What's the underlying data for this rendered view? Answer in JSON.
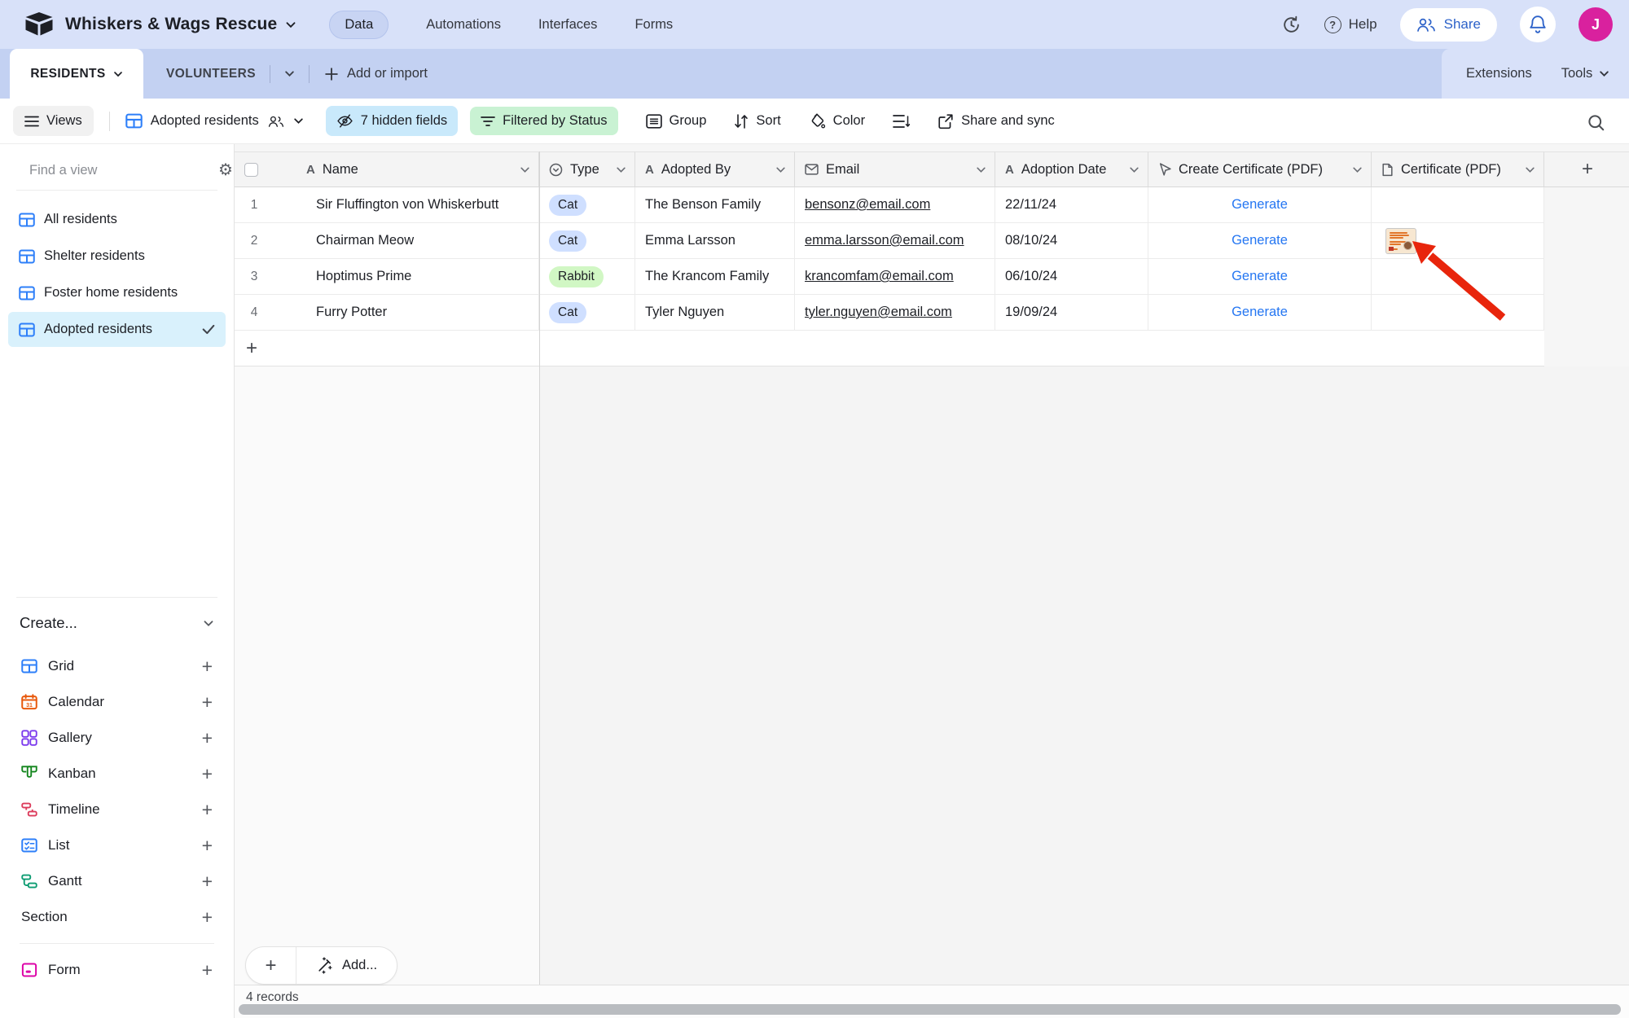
{
  "topbar": {
    "title": "Whiskers & Wags Rescue",
    "tabs": {
      "data": "Data",
      "automations": "Automations",
      "interfaces": "Interfaces",
      "forms": "Forms"
    },
    "help_label": "Help",
    "share_label": "Share",
    "avatar_initial": "J"
  },
  "tabbar": {
    "active_table": "RESIDENTS",
    "second_table": "VOLUNTEERS",
    "add_or_import_label": "Add or import",
    "extensions_label": "Extensions",
    "tools_label": "Tools"
  },
  "toolbar": {
    "views_label": "Views",
    "view_name": "Adopted residents",
    "hidden_fields_label": "7 hidden fields",
    "filter_label": "Filtered by Status",
    "group_label": "Group",
    "sort_label": "Sort",
    "color_label": "Color",
    "share_sync_label": "Share and sync"
  },
  "sidebar": {
    "find_placeholder": "Find a view",
    "views": [
      {
        "label": "All residents",
        "selected": false
      },
      {
        "label": "Shelter residents",
        "selected": false
      },
      {
        "label": "Foster home residents",
        "selected": false
      },
      {
        "label": "Adopted residents",
        "selected": true
      }
    ],
    "create_label": "Create...",
    "create_items": [
      {
        "label": "Grid"
      },
      {
        "label": "Calendar"
      },
      {
        "label": "Gallery"
      },
      {
        "label": "Kanban"
      },
      {
        "label": "Timeline"
      },
      {
        "label": "List"
      },
      {
        "label": "Gantt"
      },
      {
        "label": "Section"
      },
      {
        "label": "Form"
      }
    ]
  },
  "table": {
    "columns": [
      {
        "label": "Name",
        "type": "single-line-text"
      },
      {
        "label": "Type",
        "type": "single-select"
      },
      {
        "label": "Adopted By",
        "type": "single-line-text"
      },
      {
        "label": "Email",
        "type": "email"
      },
      {
        "label": "Adoption Date",
        "type": "single-line-text"
      },
      {
        "label": "Create Certificate (PDF)",
        "type": "button"
      },
      {
        "label": "Certificate (PDF)",
        "type": "attachment"
      }
    ],
    "rows": [
      {
        "num": "1",
        "name": "Sir Fluffington von Whiskerbutt",
        "type": "Cat",
        "chip_style": "background:#cfdfff",
        "adopted_by": "The Benson Family",
        "email": "bensonz@email.com",
        "date": "22/11/24",
        "action": "Generate",
        "attachment": ""
      },
      {
        "num": "2",
        "name": "Chairman Meow",
        "type": "Cat",
        "chip_style": "background:#cfdfff",
        "adopted_by": "Emma Larsson",
        "email": "emma.larsson@email.com",
        "date": "08/10/24",
        "action": "Generate",
        "attachment": "certificate-thumbnail"
      },
      {
        "num": "3",
        "name": "Hoptimus Prime",
        "type": "Rabbit",
        "chip_style": "background:#d1f7c4",
        "adopted_by": "The Krancom Family",
        "email": "krancomfam@email.com",
        "date": "06/10/24",
        "action": "Generate",
        "attachment": ""
      },
      {
        "num": "4",
        "name": "Furry Potter",
        "type": "Cat",
        "chip_style": "background:#cfdfff",
        "adopted_by": "Tyler Nguyen",
        "email": "tyler.nguyen@email.com",
        "date": "19/09/24",
        "action": "Generate",
        "attachment": ""
      }
    ],
    "add_button_label": "Add...",
    "records_label": "4 records"
  },
  "colors": {
    "topbar_bg": "#d8e1f9",
    "tabbar_bg": "#c3d1f2",
    "accent_blue": "#2d7ff9",
    "hidden_fields_pill": "#c9e9fb",
    "filter_pill": "#c9f2d3",
    "chip_cat": "#cfdfff",
    "chip_rabbit": "#d1f7c4",
    "selected_view_bg": "#d9f1fc",
    "generate_link": "#2476f2",
    "avatar_bg": "#d9219e",
    "annotation_arrow": "#e8250c"
  },
  "icons": {
    "gear": "⚙",
    "plus": "+",
    "question": "?"
  }
}
